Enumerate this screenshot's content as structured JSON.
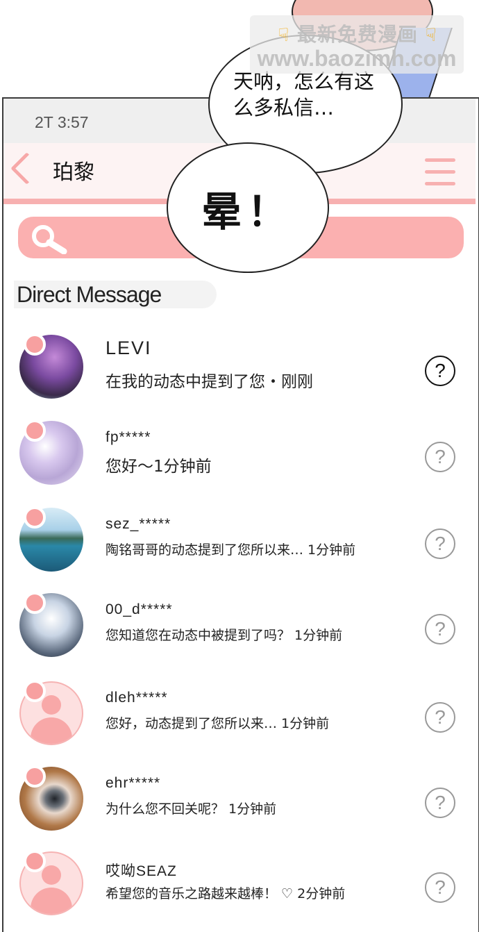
{
  "watermark": {
    "line1": "最新免费漫画",
    "line2": "www.baozimh.com",
    "hand_icon": "pointing-down-hand"
  },
  "status_bar": {
    "time": "2T 3:57"
  },
  "header": {
    "title": "珀黎",
    "back_icon": "chevron-left-icon",
    "menu_icon": "hamburger-menu-icon"
  },
  "search": {
    "icon": "search-icon"
  },
  "section": {
    "title": "Direct Message"
  },
  "speech_bubbles": [
    {
      "text": "天呐，怎么有这么多私信…"
    },
    {
      "text": "晕！"
    }
  ],
  "colors": {
    "accent_pink": "#f7b0b0",
    "search_pink": "#fbb0b0"
  },
  "messages": [
    {
      "name": "LEVI",
      "preview": "在我的动态中提到了您・刚刚",
      "avatar": "purple-hair-portrait"
    },
    {
      "name": "fp*****",
      "preview": "您好～1分钟前",
      "avatar": "purple-flowers"
    },
    {
      "name": "sez_*****",
      "preview": "陶铭哥哥的动态提到了您所以来… 1分钟前",
      "avatar": "sea-landscape"
    },
    {
      "name": "00_d*****",
      "preview": "您知道您在动态中被提到了吗？  1分钟前",
      "avatar": "person-in-light"
    },
    {
      "name": "dleh*****",
      "preview": "您好，动态提到了您所以来… 1分钟前",
      "avatar": "default-user"
    },
    {
      "name": "ehr*****",
      "preview": "为什么您不回关呢？  1分钟前",
      "avatar": "eye-closeup"
    },
    {
      "name": "哎呦SEAZ",
      "preview": "希望您的音乐之路越来越棒！ ♡ 2分钟前",
      "avatar": "default-user"
    }
  ]
}
